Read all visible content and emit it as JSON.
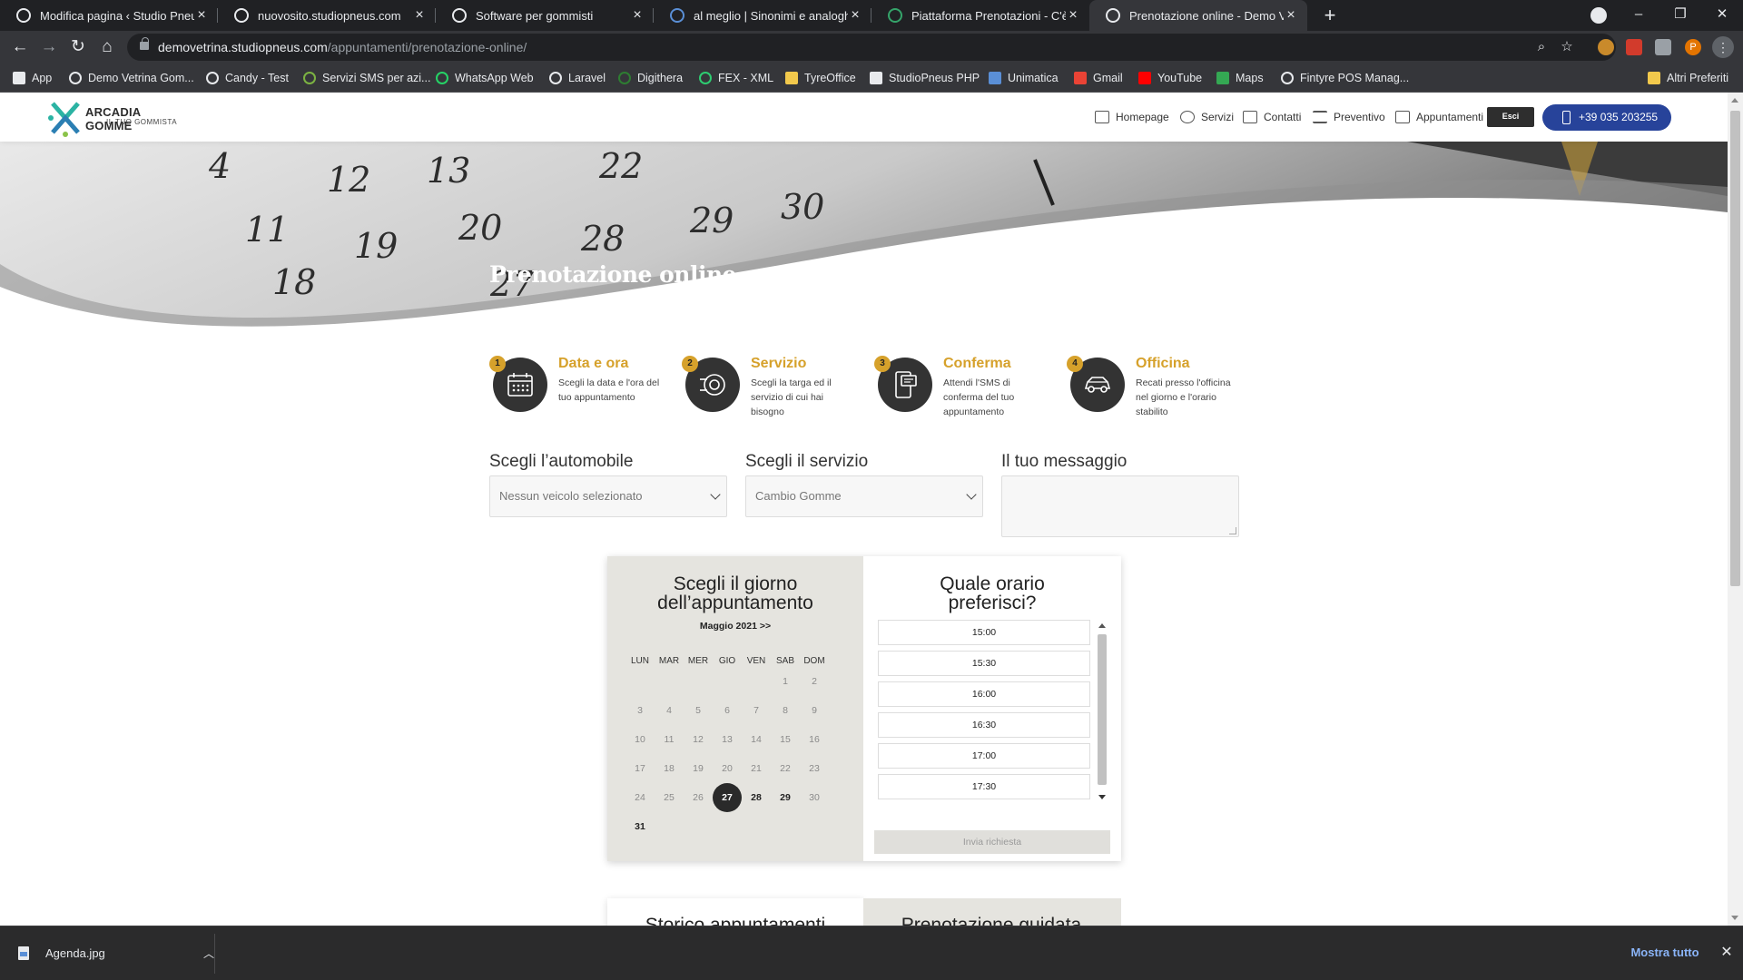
{
  "browser": {
    "tabs": [
      {
        "title": "Modifica pagina ‹ Studio Pneus C"
      },
      {
        "title": "nuovosito.studiopneus.com"
      },
      {
        "title": "Software per gommisti"
      },
      {
        "title": "al meglio | Sinonimi e analoghi p"
      },
      {
        "title": "Piattaforma Prenotazioni - C'è Po"
      },
      {
        "title": "Prenotazione online - Demo Vet"
      }
    ],
    "new_tab_symbol": "+",
    "url_domain": "demovetrina.studiopneus.com",
    "url_path": "/appuntamenti/prenotazione-online/",
    "profile_initial": "P",
    "bookmarks": [
      "App",
      "Demo Vetrina Gom...",
      "Candy - Test",
      "Servizi SMS per azi...",
      "WhatsApp Web",
      "Laravel",
      "Digithera",
      "FEX - XML",
      "TyreOffice",
      "StudioPneus PHP",
      "Unimatica",
      "Gmail",
      "YouTube",
      "Maps",
      "Fintyre POS Manag..."
    ],
    "other_bookmarks": "Altri Preferiti"
  },
  "site": {
    "logo_name": "ARCADIA GOMME",
    "logo_tagline": "IL TUO GOMMISTA",
    "nav": [
      "Homepage",
      "Servizi",
      "Contatti",
      "Preventivo",
      "Appuntamenti"
    ],
    "exit_label": "Esci",
    "phone": "+39 035 203255",
    "accent_color": "#d6a12b",
    "phone_button_color": "#27439a"
  },
  "hero": {
    "title": "Prenotazione online"
  },
  "steps": [
    {
      "num": "1",
      "title": "Data e ora",
      "desc": "Scegli la data e l'ora del tuo appuntamento",
      "icon": "calendar-icon"
    },
    {
      "num": "2",
      "title": "Servizio",
      "desc": "Scegli la targa ed il servizio di cui hai bisogno",
      "icon": "tyre-icon"
    },
    {
      "num": "3",
      "title": "Conferma",
      "desc": "Attendi l'SMS di conferma del tuo appuntamento",
      "icon": "phone-sms-icon"
    },
    {
      "num": "4",
      "title": "Officina",
      "desc": "Recati presso l'officina nel giorno e l'orario stabilito",
      "icon": "car-icon"
    }
  ],
  "form": {
    "car_label": "Scegli l’automobile",
    "car_value": "Nessun veicolo selezionato",
    "service_label": "Scegli il servizio",
    "service_value": "Cambio Gomme",
    "message_label": "Il tuo messaggio",
    "message_value": ""
  },
  "calendar": {
    "title_line1": "Scegli il giorno",
    "title_line2": "dell’appuntamento",
    "month": "Maggio 2021 >>",
    "weekdays": [
      "LUN",
      "MAR",
      "MER",
      "GIO",
      "VEN",
      "SAB",
      "DOM"
    ],
    "first_weekday_index": 5,
    "days_in_month": 31,
    "selected_day": 27,
    "available_days": [
      27,
      28,
      29,
      31
    ]
  },
  "times": {
    "title_line1": "Quale orario",
    "title_line2": "preferisci?",
    "slots": [
      "15:00",
      "15:30",
      "16:00",
      "16:30",
      "17:00",
      "17:30"
    ],
    "submit_label": "Invia richiesta"
  },
  "next_section": {
    "left_title": "Storico appuntamenti",
    "right_title": "Prenotazione guidata"
  },
  "downloads": {
    "file_name": "Agenda.jpg",
    "show_all": "Mostra tutto"
  }
}
